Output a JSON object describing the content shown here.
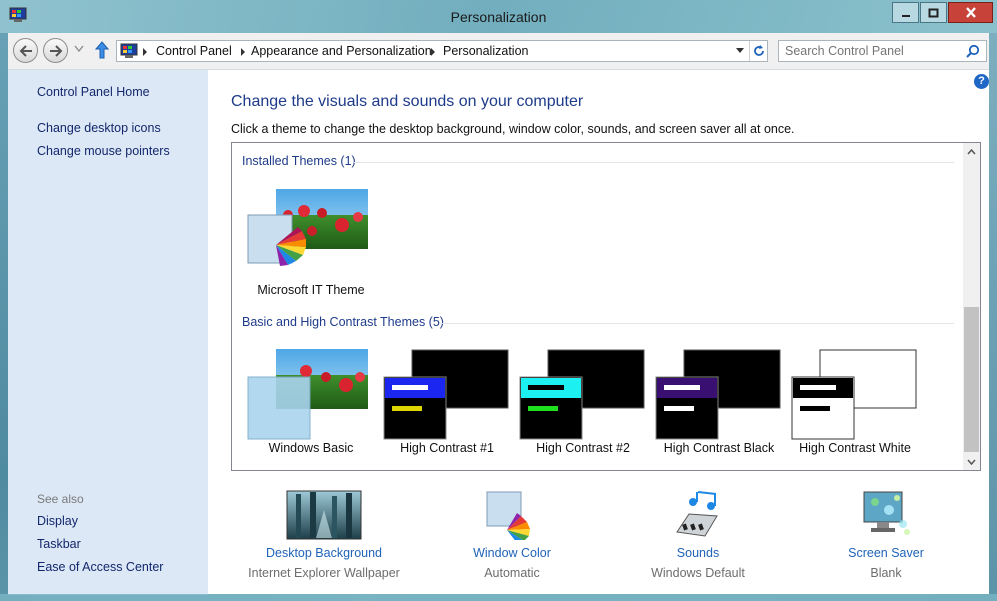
{
  "window": {
    "title": "Personalization"
  },
  "address": {
    "crumbs": [
      "Control Panel",
      "Appearance and Personalization",
      "Personalization"
    ],
    "search_placeholder": "Search Control Panel"
  },
  "sidebar": {
    "home": "Control Panel Home",
    "links": [
      "Change desktop icons",
      "Change mouse pointers"
    ],
    "see_also_label": "See also",
    "see_also": [
      "Display",
      "Taskbar",
      "Ease of Access Center"
    ]
  },
  "main": {
    "heading": "Change the visuals and sounds on your computer",
    "subtext": "Click a theme to change the desktop background, window color, sounds, and screen saver all at once.",
    "installed_header": "Installed Themes (1)",
    "installed_themes": [
      "Microsoft IT Theme"
    ],
    "basic_header": "Basic and High Contrast Themes (5)",
    "basic_themes": [
      "Windows Basic",
      "High Contrast #1",
      "High Contrast #2",
      "High Contrast Black",
      "High Contrast White"
    ]
  },
  "bottom": [
    {
      "title": "Desktop Background",
      "value": "Internet Explorer Wallpaper",
      "icon": "desktop-background-icon"
    },
    {
      "title": "Window Color",
      "value": "Automatic",
      "icon": "window-color-icon"
    },
    {
      "title": "Sounds",
      "value": "Windows Default",
      "icon": "sounds-icon"
    },
    {
      "title": "Screen Saver",
      "value": "Blank",
      "icon": "screen-saver-icon"
    }
  ],
  "colors": {
    "link": "#1f63b8",
    "heading": "#1e3b8a",
    "sidebar_bg": "#dce8f6",
    "close_button": "#c7433a"
  }
}
